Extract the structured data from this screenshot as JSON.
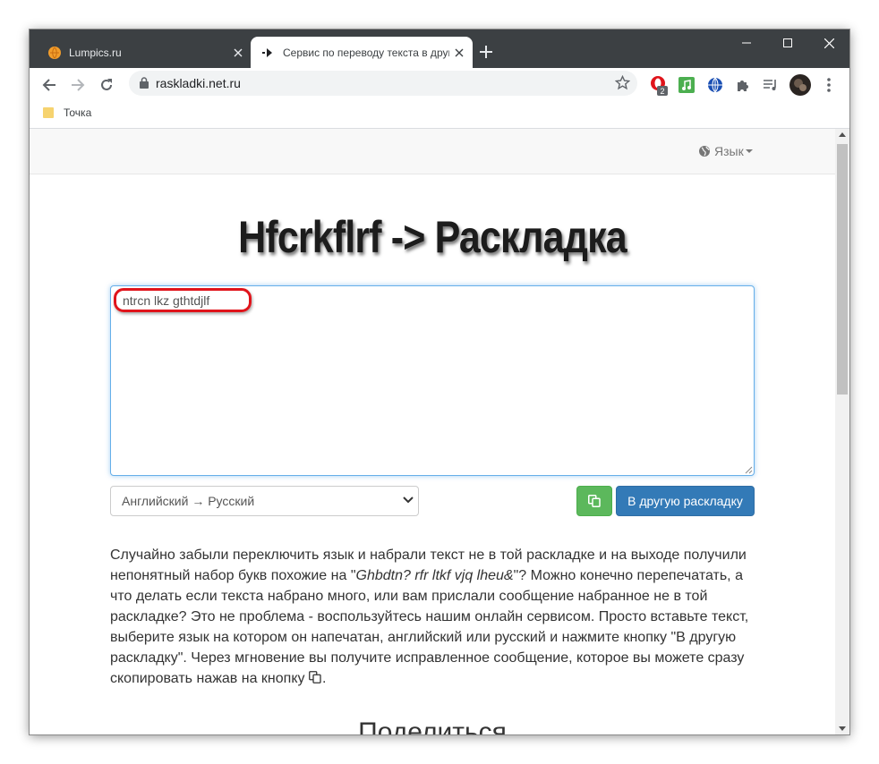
{
  "browser": {
    "tabs": [
      {
        "title": "Lumpics.ru",
        "favicon": "orange-circle-icon",
        "active": false
      },
      {
        "title": "Сервис по переводу текста в другую раскладку",
        "favicon": "arrow-icon",
        "active": true
      }
    ],
    "url": "raskladki.net.ru",
    "bookmarks": [
      {
        "label": "Точка"
      }
    ],
    "extensions": [
      {
        "name": "opera-extension-icon",
        "badge": "2"
      },
      {
        "name": "music-extension-icon"
      },
      {
        "name": "globe-extension-icon"
      },
      {
        "name": "puzzle-icon"
      },
      {
        "name": "media-control-icon"
      },
      {
        "name": "profile-avatar"
      }
    ]
  },
  "page": {
    "nav": {
      "language_label": "Язык"
    },
    "logo_text": "Hfcrkflrf -> Раскладка",
    "input_text": "ntrcn lkz gthtdjlf",
    "direction_select": {
      "selected": "Английский → Русский"
    },
    "convert_button": "В другую раскладку",
    "description": {
      "part1": "Случайно забыли переключить язык и набрали текст не в той раскладке и на выходе получили непонятный набор букв похожие на \"",
      "example": "Ghbdtn? rfr ltkf vjq lheu&",
      "part2": "\"? Можно конечно перепечатать, а что делать если текста набрано много, или вам прислали сообщение набранное не в той раскладке? Это не проблема - воспользуйтесь нашим онлайн сервисом. Просто вставьте текст, выберите язык на котором он напечатан, английский или русский и нажмите кнопку \"В другую раскладку\". Через мгновение вы получите исправленное сообщение, которое вы можете сразу скопировать нажав на кнопку",
      "part3": "."
    },
    "share_heading": "Поделиться"
  },
  "colors": {
    "tabstrip": "#3c4043",
    "highlight": "#e0141b",
    "copy_button": "#5cb85c",
    "convert_button": "#337ab7"
  }
}
